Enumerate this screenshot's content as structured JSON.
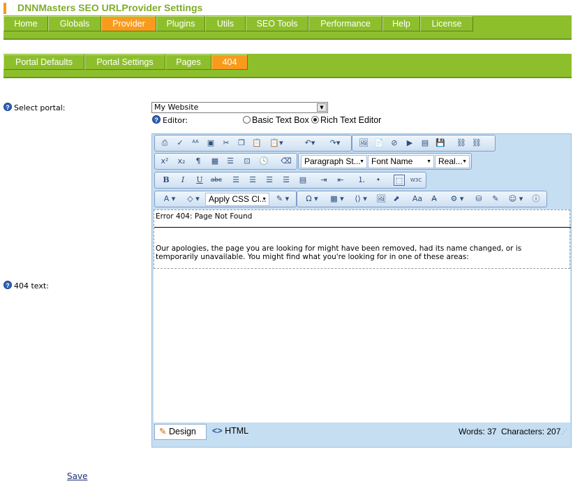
{
  "app_title": "DNNMasters SEO URLProvider Settings",
  "main_tabs": [
    {
      "label": "Home",
      "active": false
    },
    {
      "label": "Globals",
      "active": false
    },
    {
      "label": "Provider",
      "active": true
    },
    {
      "label": "Plugins",
      "active": false
    },
    {
      "label": "Utils",
      "active": false
    },
    {
      "label": "SEO Tools",
      "active": false
    },
    {
      "label": "Performance",
      "active": false
    },
    {
      "label": "Help",
      "active": false
    },
    {
      "label": "License",
      "active": false
    }
  ],
  "sub_tabs": [
    {
      "label": "Portal Defaults",
      "active": false
    },
    {
      "label": "Portal Settings",
      "active": false
    },
    {
      "label": "Pages",
      "active": false
    },
    {
      "label": "404",
      "active": true
    }
  ],
  "form": {
    "select_portal_label": "Select portal:",
    "select_portal_value": "My Website",
    "editor_label": "Editor:",
    "editor_options": [
      "Basic Text Box",
      "Rich Text Editor"
    ],
    "editor_selected": "Rich Text Editor",
    "text_404_label": "404 text:"
  },
  "toolbar": {
    "paragraph_style": "Paragraph St...",
    "font_name": "Font Name",
    "real_font_size": "Real...",
    "apply_css": "Apply CSS Cl...",
    "bold": "B",
    "italic": "I",
    "underline": "U",
    "strike": "abc"
  },
  "content": {
    "heading": "Error 404: Page Not Found",
    "paragraph_line1": "Our apologies, the page you are looking for might have been removed, had its name changed, or is",
    "paragraph_line2": "temporarily unavailable. You might find what you're looking for in one of these areas:"
  },
  "footer": {
    "design_label": "Design",
    "html_label": "HTML",
    "words": "Words: 37",
    "characters": "Characters: 207"
  },
  "save_label": "Save",
  "colors": {
    "tab_green": "#8dbf2d",
    "tab_active": "#f89b1c",
    "title_green": "#7fac2c",
    "editor_blue": "#c6def2"
  }
}
